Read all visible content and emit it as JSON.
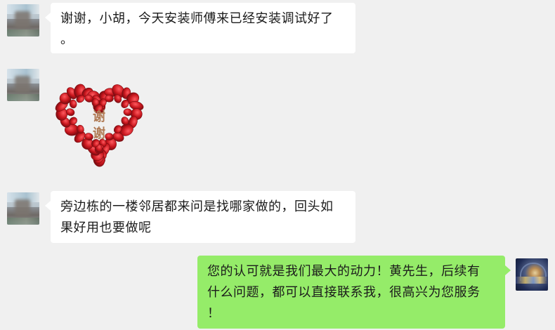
{
  "window": {
    "title": ""
  },
  "messages": [
    {
      "side": "left",
      "type": "text",
      "text": "谢谢，小胡，今天安装师傅来已经安装调试好了\n。"
    },
    {
      "side": "left",
      "type": "sticker",
      "sticker": {
        "icon": "heart-of-rose-petals-icon",
        "text_top": "谢",
        "text_bottom": "谢"
      }
    },
    {
      "side": "left",
      "type": "text",
      "text": "旁边栋的一楼邻居都来问是找哪家做的，回头如\n果好用也要做呢"
    },
    {
      "side": "right",
      "type": "text",
      "text": "您的认可就是我们最大的动力！黄先生，后续有\n什么问题，都可以直接联系我，很高兴为您服务\n！"
    }
  ],
  "colors": {
    "background": "#f0f0f0",
    "incoming_bubble": "#ffffff",
    "outgoing_bubble": "#95ec69",
    "text": "#1b1b1b",
    "heart_red": "#c8161d"
  }
}
